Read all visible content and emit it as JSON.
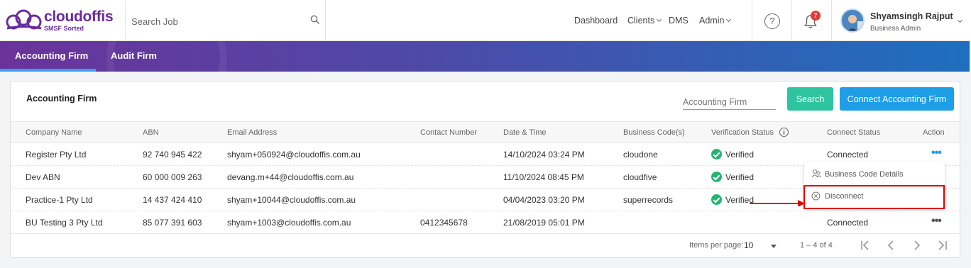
{
  "app": {
    "brand": "cloudoffis",
    "tagline": "SMSF Sorted",
    "search_placeholder": "Search Job"
  },
  "nav": {
    "dashboard": "Dashboard",
    "clients": "Clients",
    "dms": "DMS",
    "admin": "Admin"
  },
  "header": {
    "help": "?",
    "notification_count": "7",
    "user_name": "Shyamsingh Rajput",
    "user_role": "Business Admin"
  },
  "tabs": {
    "accounting": "Accounting Firm",
    "audit": "Audit Firm"
  },
  "card": {
    "title": "Accounting Firm",
    "search_placeholder": "Accounting Firm",
    "search_button": "Search",
    "connect_button": "Connect Accounting Firm"
  },
  "table": {
    "headers": {
      "company": "Company Name",
      "abn": "ABN",
      "email": "Email Address",
      "contact": "Contact Number",
      "datetime": "Date & Time",
      "codes": "Business Code(s)",
      "verification": "Verification Status",
      "connect": "Connect Status",
      "action": "Action"
    },
    "rows": [
      {
        "company": "Register Pty Ltd",
        "abn": "92 740 945 422",
        "email": "shyam+050924@cloudoffis.com.au",
        "contact": "",
        "datetime": "14/10/2024 03:24 PM",
        "code": "cloudone",
        "verification": "Verified",
        "connect": "Connected"
      },
      {
        "company": "Dev ABN",
        "abn": "60 000 009 263",
        "email": "devang.m+44@cloudoffis.com.au",
        "contact": "",
        "datetime": "11/10/2024 08:45 PM",
        "code": "cloudfive",
        "verification": "Verified",
        "connect": ""
      },
      {
        "company": "Practice-1 Pty Ltd",
        "abn": "14 437 424 410",
        "email": "shyam+10044@cloudoffis.com.au",
        "contact": "",
        "datetime": "04/04/2023 03:20 PM",
        "code": "superrecords",
        "verification": "Verified",
        "connect": ""
      },
      {
        "company": "BU Testing 3 Pty Ltd",
        "abn": "85 077 391 603",
        "email": "shyam+1003@cloudoffis.com.au",
        "contact": "0412345678",
        "datetime": "21/08/2019 05:01 PM",
        "code": "",
        "verification": "",
        "connect": "Connected"
      }
    ]
  },
  "pager": {
    "items_label": "Items per page:",
    "page_size": "10",
    "range": "1 – 4 of 4"
  },
  "menu": {
    "business_code_details": "Business Code Details",
    "disconnect": "Disconnect"
  },
  "colors": {
    "brand": "#6a2aa0",
    "search_button": "#2ec4a0",
    "connect_button": "#1d9ee6",
    "verified": "#22b573",
    "highlight": "#e00000"
  }
}
